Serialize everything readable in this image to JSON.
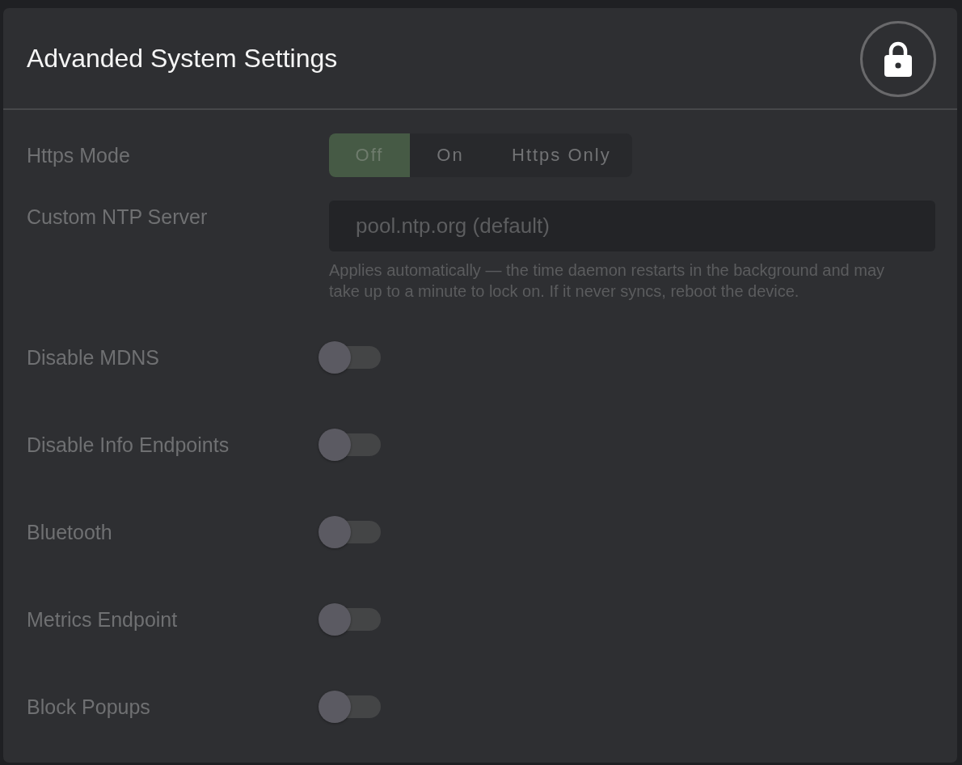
{
  "header": {
    "title": "Advanded System Settings"
  },
  "settings": [
    {
      "kind": "segmented",
      "label": "Https Mode",
      "options": [
        {
          "label": "Off",
          "selected": true
        },
        {
          "label": "On",
          "selected": false
        },
        {
          "label": "Https Only",
          "selected": false
        }
      ]
    },
    {
      "kind": "text",
      "label": "Custom NTP Server",
      "placeholder": "pool.ntp.org (default)",
      "help": "Applies automatically — the time daemon restarts in the background and may take up to a minute to lock on. If it never syncs, reboot the device."
    },
    {
      "kind": "toggle",
      "label": "Disable MDNS",
      "on": false
    },
    {
      "kind": "toggle",
      "label": "Disable Info Endpoints",
      "on": false
    },
    {
      "kind": "toggle",
      "label": "Bluetooth",
      "on": false
    },
    {
      "kind": "toggle",
      "label": "Metrics Endpoint",
      "on": false
    },
    {
      "kind": "toggle",
      "label": "Block Popups",
      "on": false
    }
  ]
}
